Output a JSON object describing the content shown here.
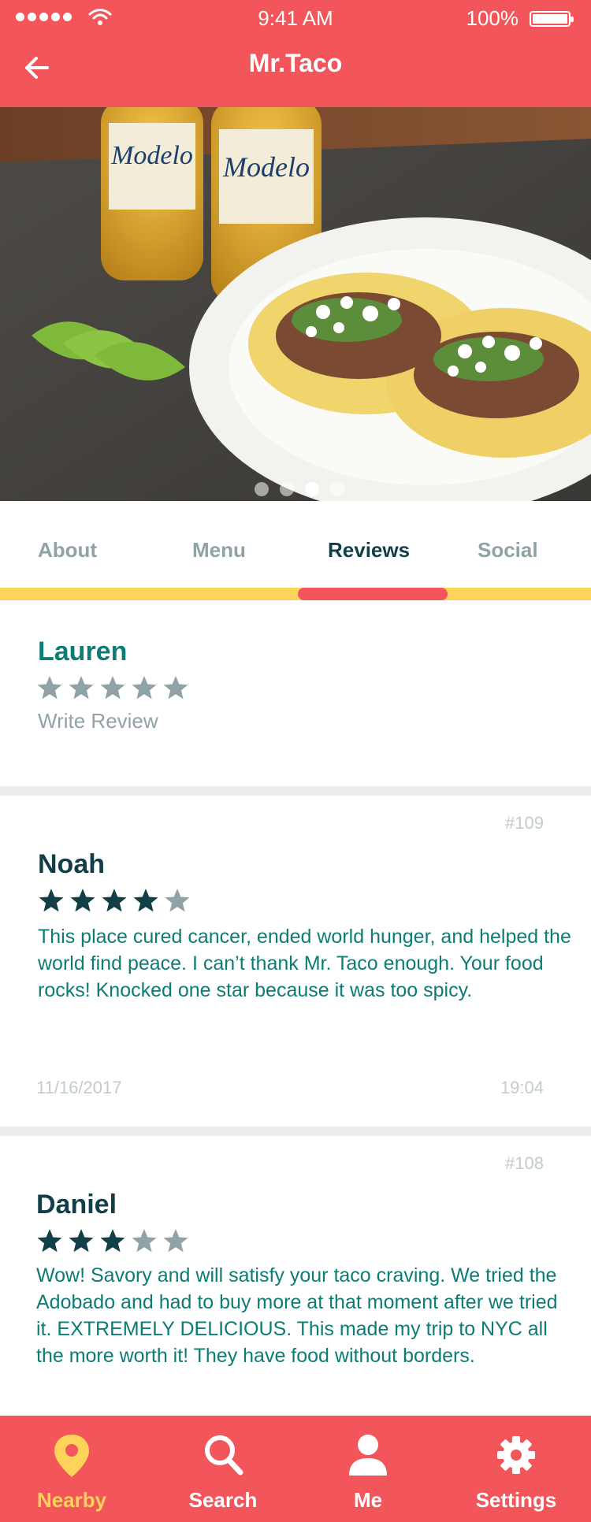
{
  "status_bar": {
    "time": "9:41 AM",
    "battery": "100%"
  },
  "header": {
    "title": "Mr.Taco",
    "back_icon": "arrow-left-icon"
  },
  "gallery": {
    "image": "tacos-with-modelo-beer-and-limes-photo",
    "page_count": 4,
    "active_page": 3
  },
  "tabs": [
    {
      "label": "About",
      "active": false
    },
    {
      "label": "Menu",
      "active": false
    },
    {
      "label": "Reviews",
      "active": true
    },
    {
      "label": "Social",
      "active": false
    }
  ],
  "my_review": {
    "name": "Lauren",
    "rating": 0,
    "max": 5,
    "action": "Write Review"
  },
  "reviews": [
    {
      "number": "#109",
      "author": "Noah",
      "rating": 4,
      "text": "This place cured cancer, ended world hunger, and helped the world find peace. I can’t thank Mr. Taco enough. Your food rocks! Knocked one star because it was too spicy.",
      "date": "11/16/2017",
      "time": "19:04"
    },
    {
      "number": "#108",
      "author": "Daniel",
      "rating": 3,
      "text": "Wow! Savory and will satisfy your taco craving. We tried the Adobado and had to buy more at that moment after we tried it. EXTREMELY DELICIOUS. This made my trip to NYC all the more worth it! They have food without borders.",
      "date": "",
      "time": ""
    }
  ],
  "bottom_nav": [
    {
      "label": "Nearby",
      "icon": "location-pin-icon",
      "active": true
    },
    {
      "label": "Search",
      "icon": "search-icon",
      "active": false
    },
    {
      "label": "Me",
      "icon": "person-icon",
      "active": false
    },
    {
      "label": "Settings",
      "icon": "gear-icon",
      "active": false
    }
  ],
  "colors": {
    "primary": "#f2555a",
    "accent": "#fdd35a",
    "teal": "#0d7c74",
    "dark_teal": "#123f47",
    "muted": "#8fa3a6"
  }
}
